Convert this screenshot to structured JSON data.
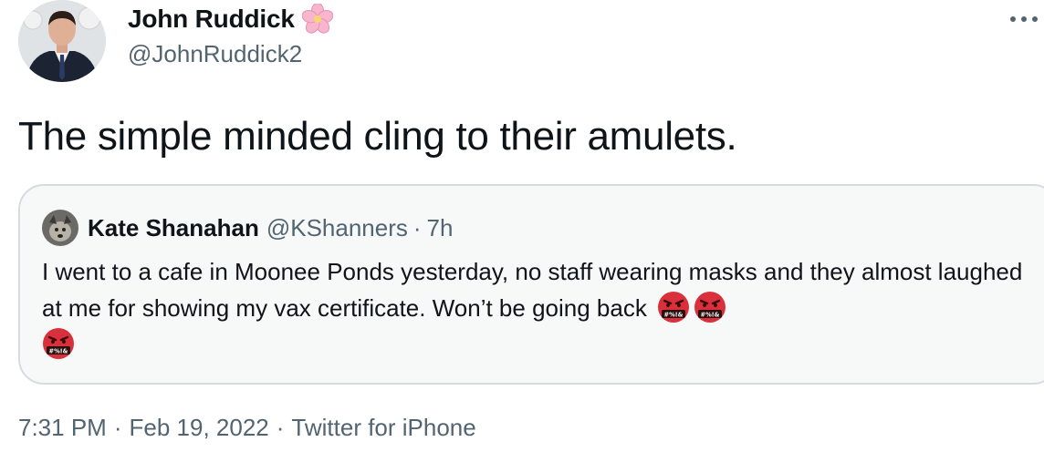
{
  "author": {
    "name": "John Ruddick",
    "handle": "@JohnRuddick2",
    "avatar_icon": "person-in-suit-avatar",
    "badge_icon": "cherry-blossom-icon"
  },
  "tweet": {
    "text": "The simple minded cling to their amulets."
  },
  "quoted": {
    "name": "Kate Shanahan",
    "handle": "@KShanners",
    "separator": "·",
    "time": "7h",
    "text": "I went to a cafe in Moonee Ponds yesterday, no staff wearing masks and they almost laughed at me for showing my vax certificate. Won’t be going back",
    "emoji_icon": "face-with-symbols-on-mouth-icon",
    "emoji_count": 3
  },
  "meta": {
    "time": "7:31 PM",
    "separator": "·",
    "date": "Feb 19, 2022",
    "source": "Twitter for iPhone"
  },
  "colors": {
    "text": "#0f1419",
    "secondary": "#536471",
    "card_border": "#d6dbdf",
    "card_bg": "#f7f9f9",
    "emoji_red": "#d9303c"
  }
}
